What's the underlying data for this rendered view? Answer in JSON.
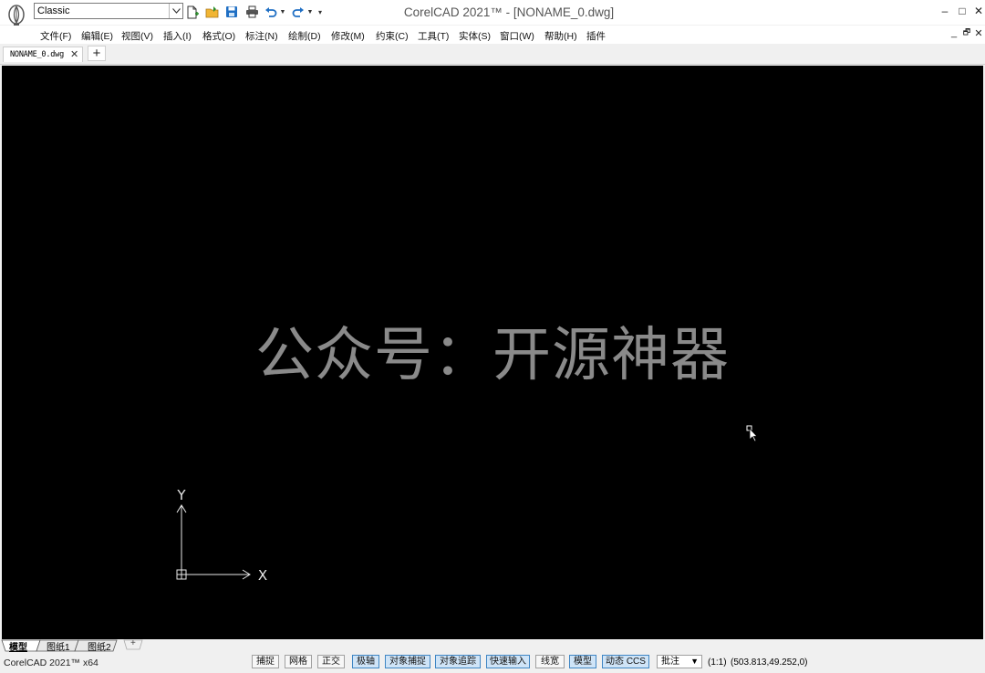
{
  "window": {
    "title": "CorelCAD 2021™ - [NONAME_0.dwg]",
    "workspace": "Classic",
    "controls": {
      "minimize": "‒",
      "maximize": "□",
      "close": "✕"
    },
    "mdi_controls": {
      "minimize": "_",
      "restore": "🗗",
      "close": "✕"
    }
  },
  "quick_access": [
    {
      "name": "new-document-icon"
    },
    {
      "name": "open-folder-icon"
    },
    {
      "name": "save-icon"
    },
    {
      "name": "print-icon"
    },
    {
      "name": "undo-icon"
    },
    {
      "name": "redo-icon"
    },
    {
      "name": "customize-toolbar-icon"
    }
  ],
  "menu": [
    "文件(F)",
    "编辑(E)",
    "视图(V)",
    "插入(I)",
    "格式(O)",
    "标注(N)",
    "绘制(D)",
    "修改(M)",
    "约束(C)",
    "工具(T)",
    "实体(S)",
    "窗口(W)",
    "帮助(H)",
    "插件"
  ],
  "tabs": {
    "document": "NONAME_0.dwg",
    "close": "✕",
    "add": "+"
  },
  "canvas": {
    "background": "#000000",
    "watermark": "公众号：开源神器",
    "ucs_x_label": "X",
    "ucs_y_label": "Y"
  },
  "layout_tabs": [
    "模型",
    "图纸1",
    "图纸2",
    "+"
  ],
  "status": {
    "app": "CorelCAD 2021™ x64",
    "toggles": [
      {
        "label": "捕捉",
        "on": false
      },
      {
        "label": "网格",
        "on": false
      },
      {
        "label": "正交",
        "on": false
      },
      {
        "label": "极轴",
        "on": true
      },
      {
        "label": "对象捕捉",
        "on": true
      },
      {
        "label": "对象追踪",
        "on": true
      },
      {
        "label": "快速输入",
        "on": true
      },
      {
        "label": "线宽",
        "on": false
      },
      {
        "label": "模型",
        "on": true
      },
      {
        "label": "动态 CCS",
        "on": true
      }
    ],
    "annotation_label": "批注",
    "scale": "(1:1)",
    "coordinates": "(503.813,49.252,0)"
  },
  "colors": {
    "accent": "#3f86c4",
    "toggle_on": "#cfe4f7",
    "canvas": "#000000"
  }
}
